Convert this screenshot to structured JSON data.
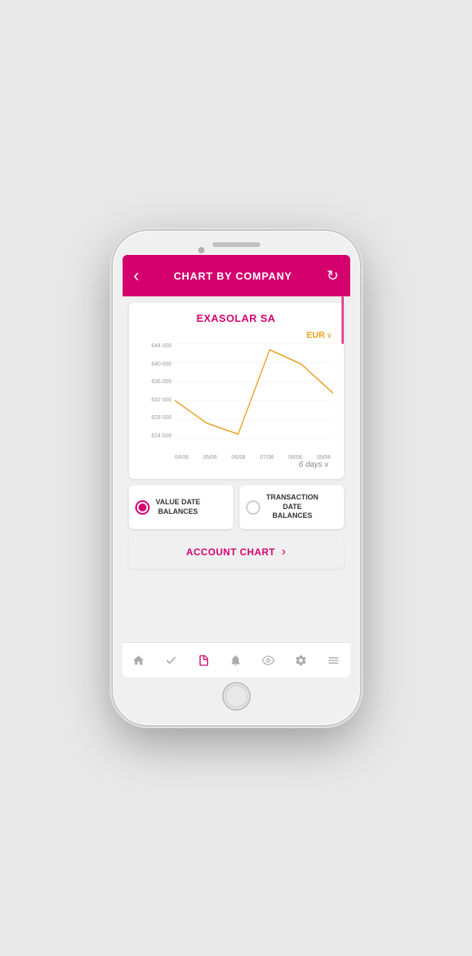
{
  "phone": {
    "header": {
      "title": "CHART BY COMPANY",
      "back_label": "‹",
      "refresh_label": "↺"
    },
    "company": {
      "name": "EXASOLAR SA"
    },
    "currency": {
      "label": "EUR",
      "arrow": "∨"
    },
    "chart": {
      "y_labels": [
        "644 000",
        "640 000",
        "636 000",
        "632 000",
        "628 000",
        "624 000"
      ],
      "x_labels": [
        "04/06",
        "05/06",
        "06/06",
        "07/06",
        "08/06",
        "09/06"
      ],
      "days_label": "6 days",
      "days_arrow": "∨"
    },
    "radio_options": [
      {
        "id": "value-date",
        "label": "VALUE DATE\nBALANCES",
        "selected": true
      },
      {
        "id": "transaction-date",
        "label": "TRANSACTION\nDATE\nBALANCES",
        "selected": false
      }
    ],
    "account_chart_button": {
      "label": "ACCOUNT CHART",
      "arrow": "›"
    },
    "bottom_nav": [
      {
        "icon": "🏠",
        "name": "home",
        "active": false
      },
      {
        "icon": "✓",
        "name": "check",
        "active": false
      },
      {
        "icon": "📋",
        "name": "document",
        "active": true
      },
      {
        "icon": "🔔",
        "name": "bell",
        "active": false
      },
      {
        "icon": "👁",
        "name": "eye",
        "active": false
      },
      {
        "icon": "⚙",
        "name": "settings",
        "active": false
      },
      {
        "icon": "≡",
        "name": "menu",
        "active": false
      }
    ]
  }
}
